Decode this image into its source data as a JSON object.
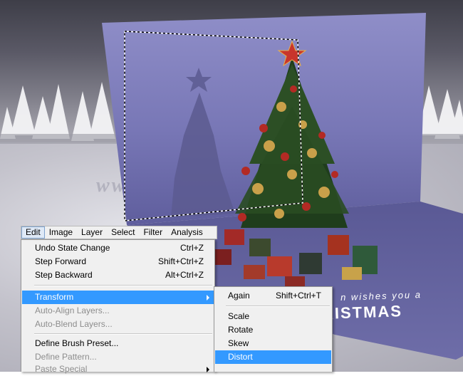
{
  "menubar": {
    "items": [
      "Edit",
      "Image",
      "Layer",
      "Select",
      "Filter",
      "Analysis"
    ]
  },
  "edit_menu": {
    "undo_state_change": {
      "label": "Undo State Change",
      "shortcut": "Ctrl+Z"
    },
    "step_forward": {
      "label": "Step Forward",
      "shortcut": "Shift+Ctrl+Z"
    },
    "step_backward": {
      "label": "Step Backward",
      "shortcut": "Alt+Ctrl+Z"
    },
    "transform": {
      "label": "Transform"
    },
    "auto_align_layers": {
      "label": "Auto-Align Layers..."
    },
    "auto_blend_layers": {
      "label": "Auto-Blend Layers..."
    },
    "define_brush_preset": {
      "label": "Define Brush Preset..."
    },
    "define_pattern": {
      "label": "Define Pattern..."
    },
    "paste_special": {
      "label": "Paste Special"
    }
  },
  "transform_menu": {
    "again": {
      "label": "Again",
      "shortcut": "Shift+Ctrl+T"
    },
    "scale": {
      "label": "Scale"
    },
    "rotate": {
      "label": "Rotate"
    },
    "skew": {
      "label": "Skew"
    },
    "distort": {
      "label": "Distort"
    }
  },
  "canvas": {
    "watermark": "www.psd-d",
    "greeting_line": "n wishes you a",
    "greeting_big": "RISTMAS"
  },
  "colors": {
    "menu_bg": "#f0f0f0",
    "highlight": "#3399ff",
    "card_purple": "#8382bf",
    "card_base": "#5d5c97",
    "disabled_text": "#8d8d8d"
  }
}
